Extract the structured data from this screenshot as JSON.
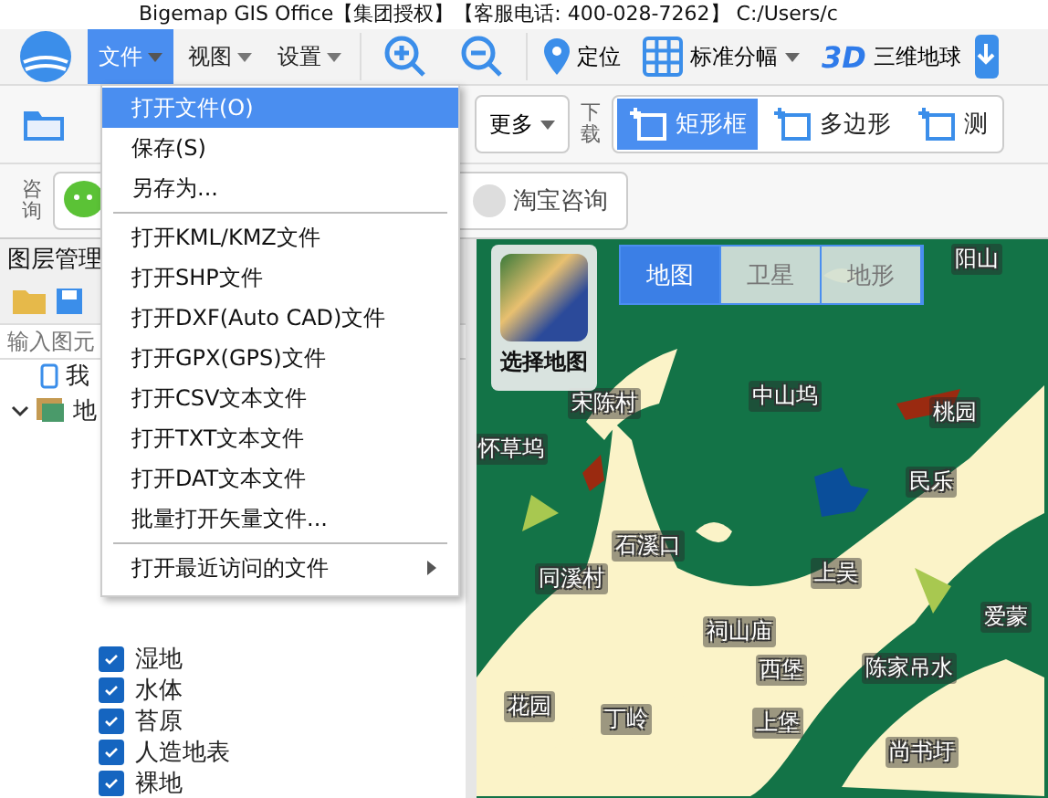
{
  "window": {
    "title": "Bigemap GIS Office【集团授权】【客服电话: 400-028-7262】 C:/Users/c"
  },
  "menubar": [
    {
      "label": "文件",
      "selected": true
    },
    {
      "label": "视图",
      "selected": false
    },
    {
      "label": "设置",
      "selected": false
    }
  ],
  "toolbar": {
    "locate": "定位",
    "sheet": "标准分幅",
    "globe_badge": "3D",
    "globe": "三维地球"
  },
  "toolbar2": {
    "more": "更多",
    "download": "下载",
    "draw_tools": [
      {
        "label": "矩形框",
        "selected": true
      },
      {
        "label": "多边形",
        "selected": false
      },
      {
        "label": "测",
        "selected": false
      }
    ]
  },
  "consult": {
    "label": "咨询",
    "items": [
      "淘宝咨询"
    ]
  },
  "layer_panel": {
    "title": "图层管理",
    "search": {
      "placeholder": "输入图元"
    },
    "tree": [
      {
        "label": "我",
        "kind": "phone"
      },
      {
        "label": "地",
        "kind": "folder",
        "expanded": true,
        "children": [
          {
            "label": "湿地",
            "checked": true
          },
          {
            "label": "水体",
            "checked": true
          },
          {
            "label": "苔原",
            "checked": true
          },
          {
            "label": "人造地表",
            "checked": true
          },
          {
            "label": "裸地",
            "checked": true
          }
        ]
      }
    ]
  },
  "file_menu": [
    {
      "kind": "item",
      "label": "打开文件(O)",
      "selected": true
    },
    {
      "kind": "item",
      "label": "保存(S)",
      "selected": false
    },
    {
      "kind": "item",
      "label": "另存为...",
      "selected": false
    },
    {
      "kind": "separator"
    },
    {
      "kind": "item",
      "label": "打开KML/KMZ文件",
      "selected": false
    },
    {
      "kind": "item",
      "label": "打开SHP文件",
      "selected": false
    },
    {
      "kind": "item",
      "label": "打开DXF(Auto CAD)文件",
      "selected": false
    },
    {
      "kind": "item",
      "label": "打开GPX(GPS)文件",
      "selected": false
    },
    {
      "kind": "item",
      "label": "打开CSV文本文件",
      "selected": false
    },
    {
      "kind": "item",
      "label": "打开TXT文本文件",
      "selected": false
    },
    {
      "kind": "item",
      "label": "打开DAT文本文件",
      "selected": false
    },
    {
      "kind": "item",
      "label": "批量打开矢量文件...",
      "selected": false
    },
    {
      "kind": "separator"
    },
    {
      "kind": "submenu",
      "label": "打开最近访问的文件",
      "selected": false
    }
  ],
  "map": {
    "picker": "选择地图",
    "tabs": [
      {
        "label": "地图",
        "selected": true
      },
      {
        "label": "卫星",
        "selected": false
      },
      {
        "label": "地形",
        "selected": false
      }
    ],
    "labels": [
      "阳山",
      "宋陈村",
      "中山坞",
      "桃园",
      "怀草坞",
      "民乐",
      "石溪口",
      "同溪村",
      "上吴",
      "祠山庙",
      "爱蒙",
      "西堡",
      "陈家吊水",
      "花园",
      "丁岭",
      "上堡",
      "尚书圩"
    ]
  }
}
